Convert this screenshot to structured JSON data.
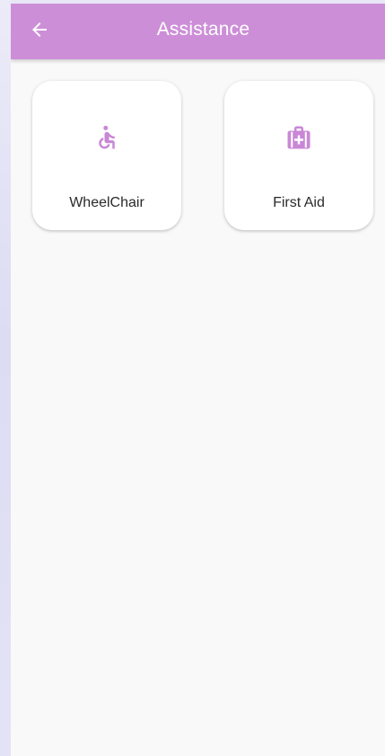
{
  "appbar": {
    "title": "Assistance",
    "background_color": "#cd8ed8",
    "back_icon": "arrow-left-icon"
  },
  "services": [
    {
      "label": "WheelChair",
      "icon": "wheelchair-icon",
      "icon_color": "#c987d6"
    },
    {
      "label": "First Aid",
      "icon": "first-aid-kit-icon",
      "icon_color": "#c987d6"
    }
  ]
}
